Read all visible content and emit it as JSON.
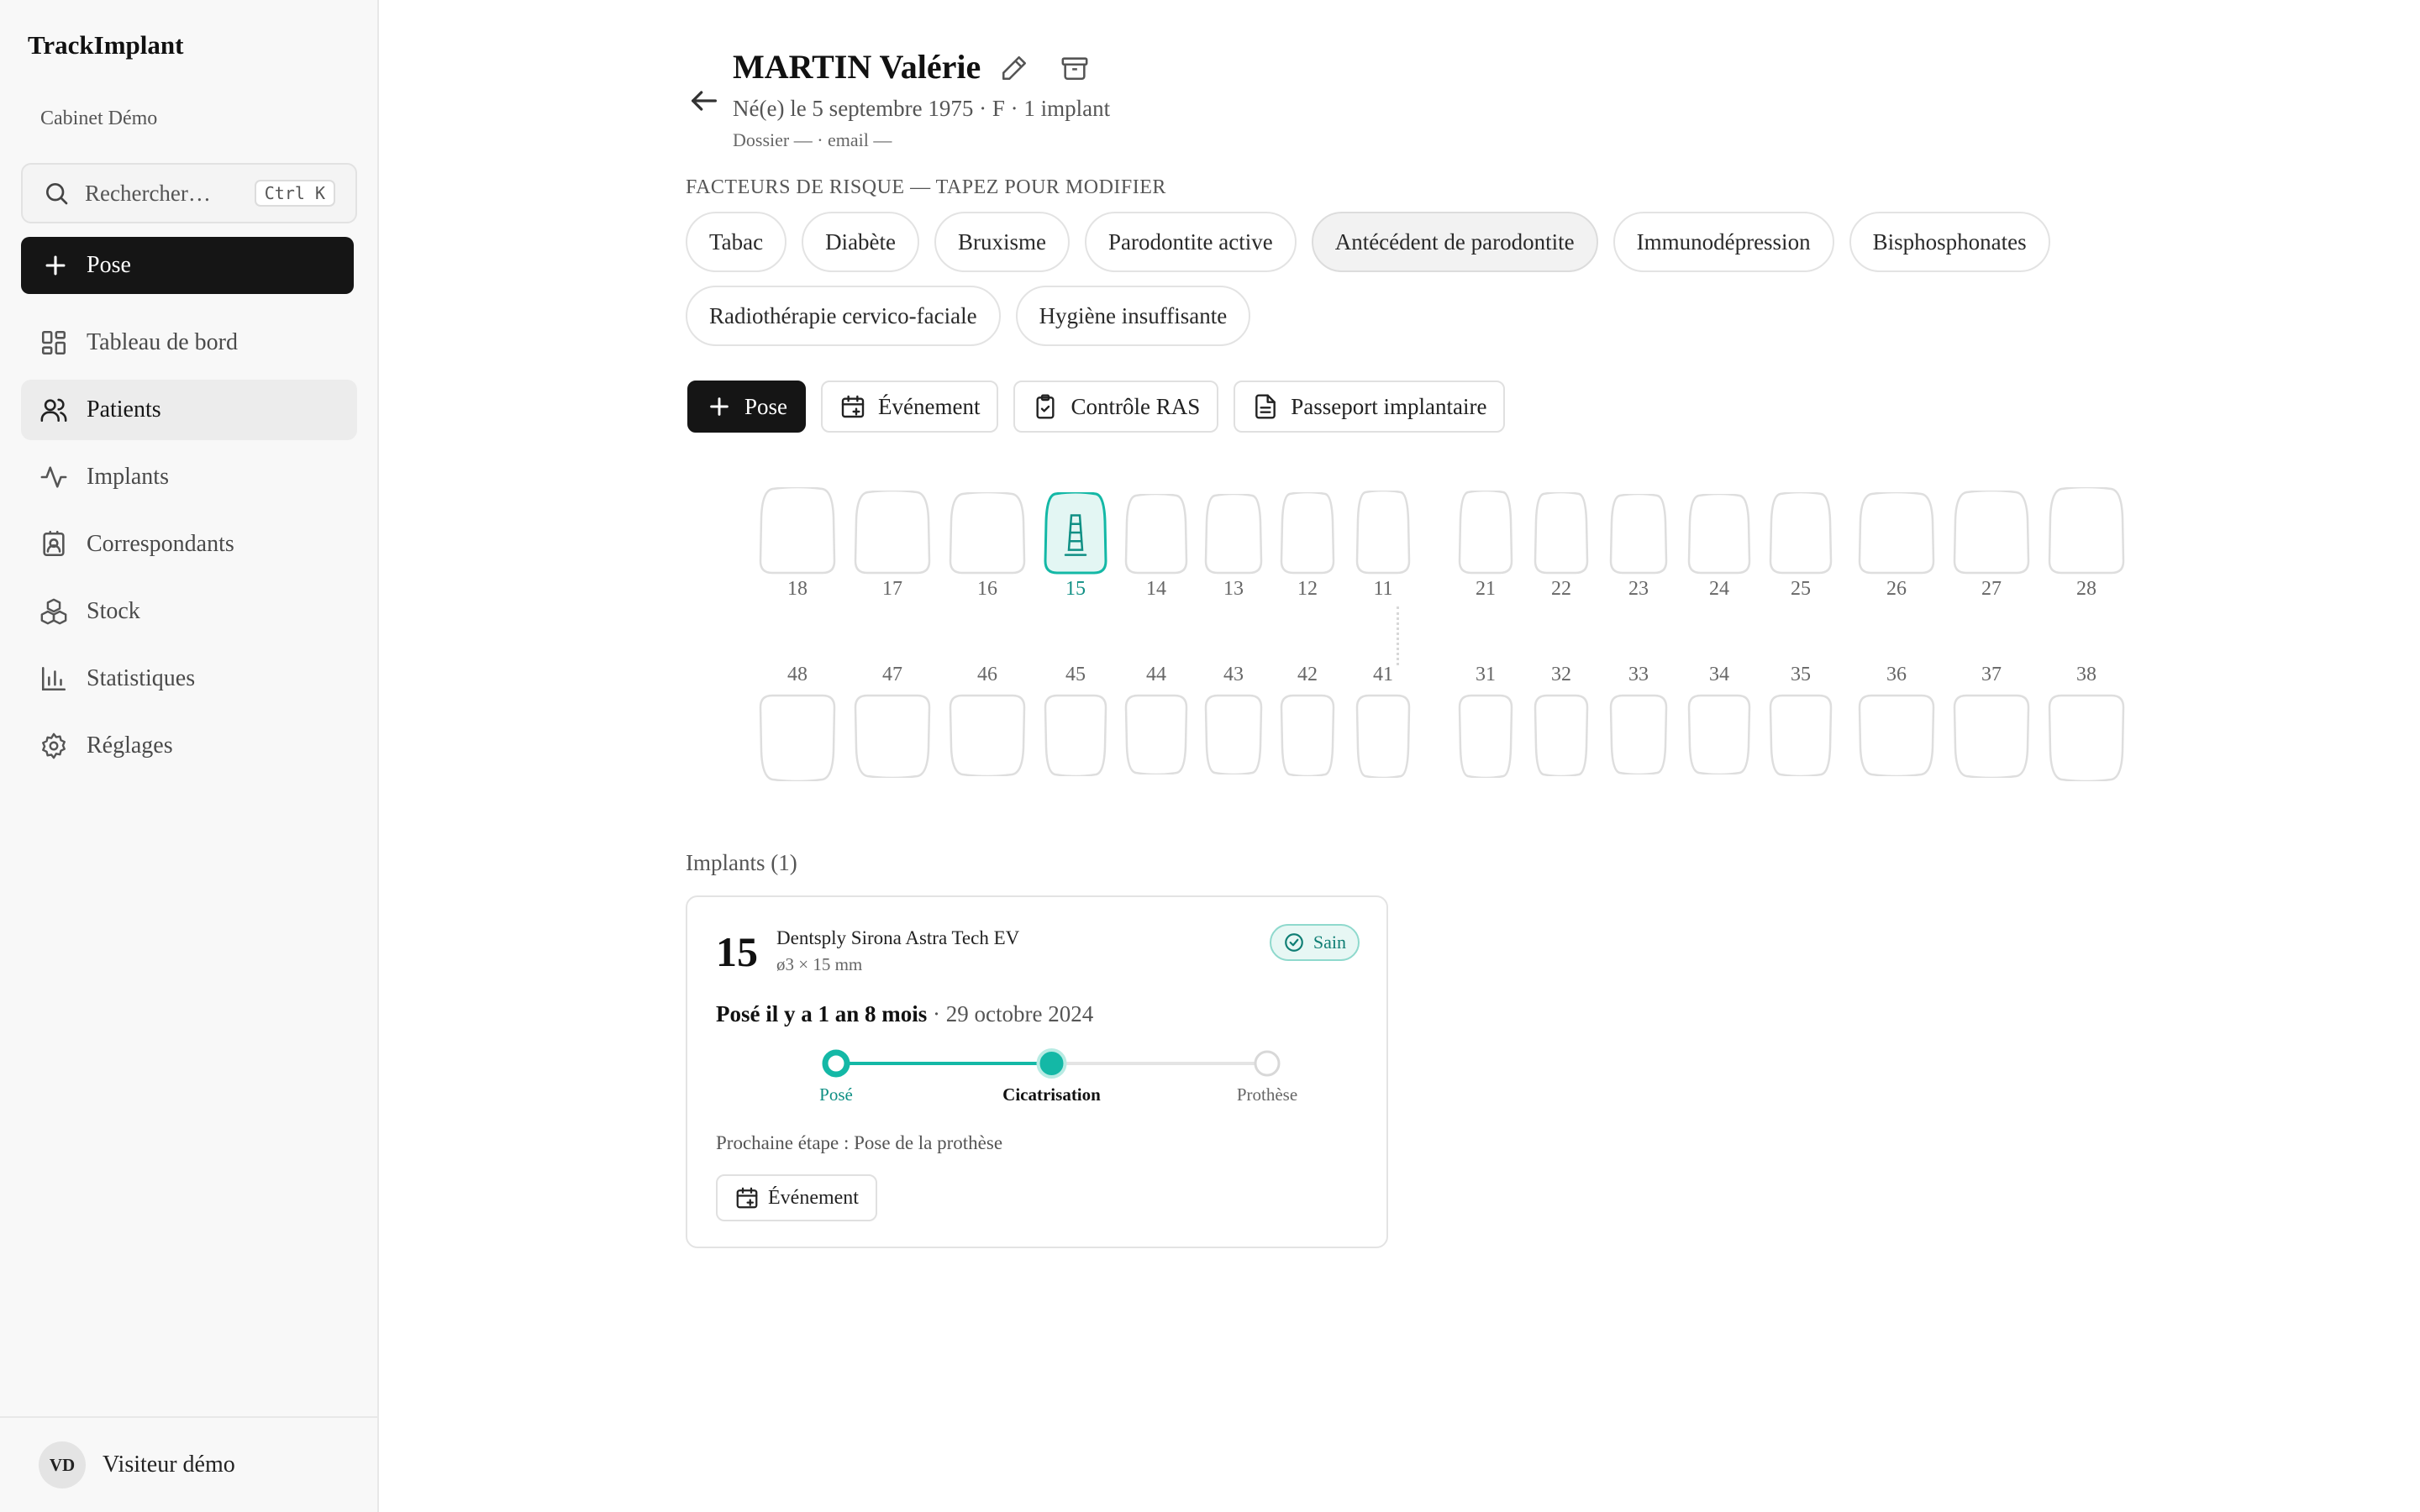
{
  "app": {
    "name": "TrackImplant",
    "cabinet": "Cabinet Démo"
  },
  "search": {
    "placeholder": "Rechercher…",
    "shortcut": "Ctrl K"
  },
  "sidebar": {
    "new_button": "Pose",
    "items": [
      {
        "label": "Tableau de bord",
        "icon": "dashboard-icon",
        "active": false
      },
      {
        "label": "Patients",
        "icon": "users-icon",
        "active": true
      },
      {
        "label": "Implants",
        "icon": "activity-icon",
        "active": false
      },
      {
        "label": "Correspondants",
        "icon": "contact-icon",
        "active": false
      },
      {
        "label": "Stock",
        "icon": "boxes-icon",
        "active": false
      },
      {
        "label": "Statistiques",
        "icon": "chart-icon",
        "active": false
      },
      {
        "label": "Réglages",
        "icon": "gear-icon",
        "active": false
      }
    ],
    "user": {
      "initials": "VD",
      "name": "Visiteur démo"
    }
  },
  "patient": {
    "name": "MARTIN Valérie",
    "meta": "Né(e) le 5 septembre 1975 · F · 1 implant",
    "dossier": "Dossier — · email —"
  },
  "risk": {
    "title": "Facteurs de risque — tapez pour modifier",
    "chips": [
      {
        "label": "Tabac",
        "selected": false
      },
      {
        "label": "Diabète",
        "selected": false
      },
      {
        "label": "Bruxisme",
        "selected": false
      },
      {
        "label": "Parodontite active",
        "selected": false
      },
      {
        "label": "Antécédent de parodontite",
        "selected": true
      },
      {
        "label": "Immunodépression",
        "selected": false
      },
      {
        "label": "Bisphosphonates",
        "selected": false
      },
      {
        "label": "Radiothérapie cervico-faciale",
        "selected": false
      },
      {
        "label": "Hygiène insuffisante",
        "selected": false
      }
    ]
  },
  "actions": {
    "pose": "Pose",
    "event": "Événement",
    "control": "Contrôle RAS",
    "passport": "Passeport implantaire"
  },
  "teeth": {
    "upper": [
      "18",
      "17",
      "16",
      "15",
      "14",
      "13",
      "12",
      "11",
      "21",
      "22",
      "23",
      "24",
      "25",
      "26",
      "27",
      "28"
    ],
    "lower": [
      "48",
      "47",
      "46",
      "45",
      "44",
      "43",
      "42",
      "41",
      "31",
      "32",
      "33",
      "34",
      "35",
      "36",
      "37",
      "38"
    ],
    "implanted": [
      "15"
    ],
    "implant_color": "#14b8a6"
  },
  "implants": {
    "heading": "Implants (1)",
    "cards": [
      {
        "tooth": "15",
        "brand": "Dentsply Sirona Astra Tech EV",
        "dims": "ø3 × 15 mm",
        "status": "Sain",
        "since_bold": "Posé il y a 1 an 8 mois",
        "since_date": "· 29 octobre 2024",
        "steps": [
          "Posé",
          "Cicatrisation",
          "Prothèse"
        ],
        "current_step": 1,
        "next": "Prochaine étape : Pose de la prothèse",
        "event_button": "Événement"
      }
    ]
  },
  "colors": {
    "accent": "#14b8a6",
    "dark": "#151515"
  }
}
